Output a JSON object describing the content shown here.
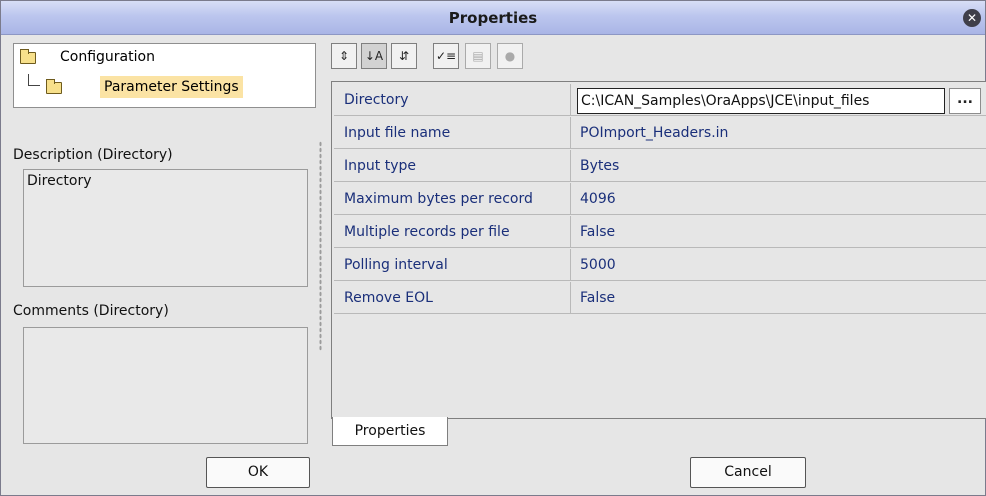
{
  "window": {
    "title": "Properties"
  },
  "tree": {
    "root_label": "Configuration",
    "child_label": "Parameter Settings"
  },
  "description": {
    "label": "Description (Directory)",
    "value": "Directory"
  },
  "comments": {
    "label": "Comments (Directory)",
    "value": ""
  },
  "toolbar": {
    "buttons": [
      {
        "name": "expand-icon",
        "glyph": "⇕"
      },
      {
        "name": "sort-az-icon",
        "glyph": "↓A"
      },
      {
        "name": "sort-category-icon",
        "glyph": "⇵"
      },
      {
        "name": "checklist-icon",
        "glyph": "✓≡"
      },
      {
        "name": "grid-icon",
        "glyph": "▤"
      },
      {
        "name": "help-icon",
        "glyph": "●"
      }
    ]
  },
  "properties": {
    "rows": [
      {
        "name": "Directory",
        "value": "C:\\ICAN_Samples\\OraApps\\JCE\\input_files"
      },
      {
        "name": "Input file name",
        "value": "POImport_Headers.in"
      },
      {
        "name": "Input type",
        "value": "Bytes"
      },
      {
        "name": "Maximum bytes per record",
        "value": "4096"
      },
      {
        "name": "Multiple records per file",
        "value": "False"
      },
      {
        "name": "Polling interval",
        "value": "5000"
      },
      {
        "name": "Remove EOL",
        "value": "False"
      }
    ],
    "browse_label": "...",
    "tab_label": "Properties"
  },
  "buttons": {
    "ok": "OK",
    "cancel": "Cancel"
  }
}
